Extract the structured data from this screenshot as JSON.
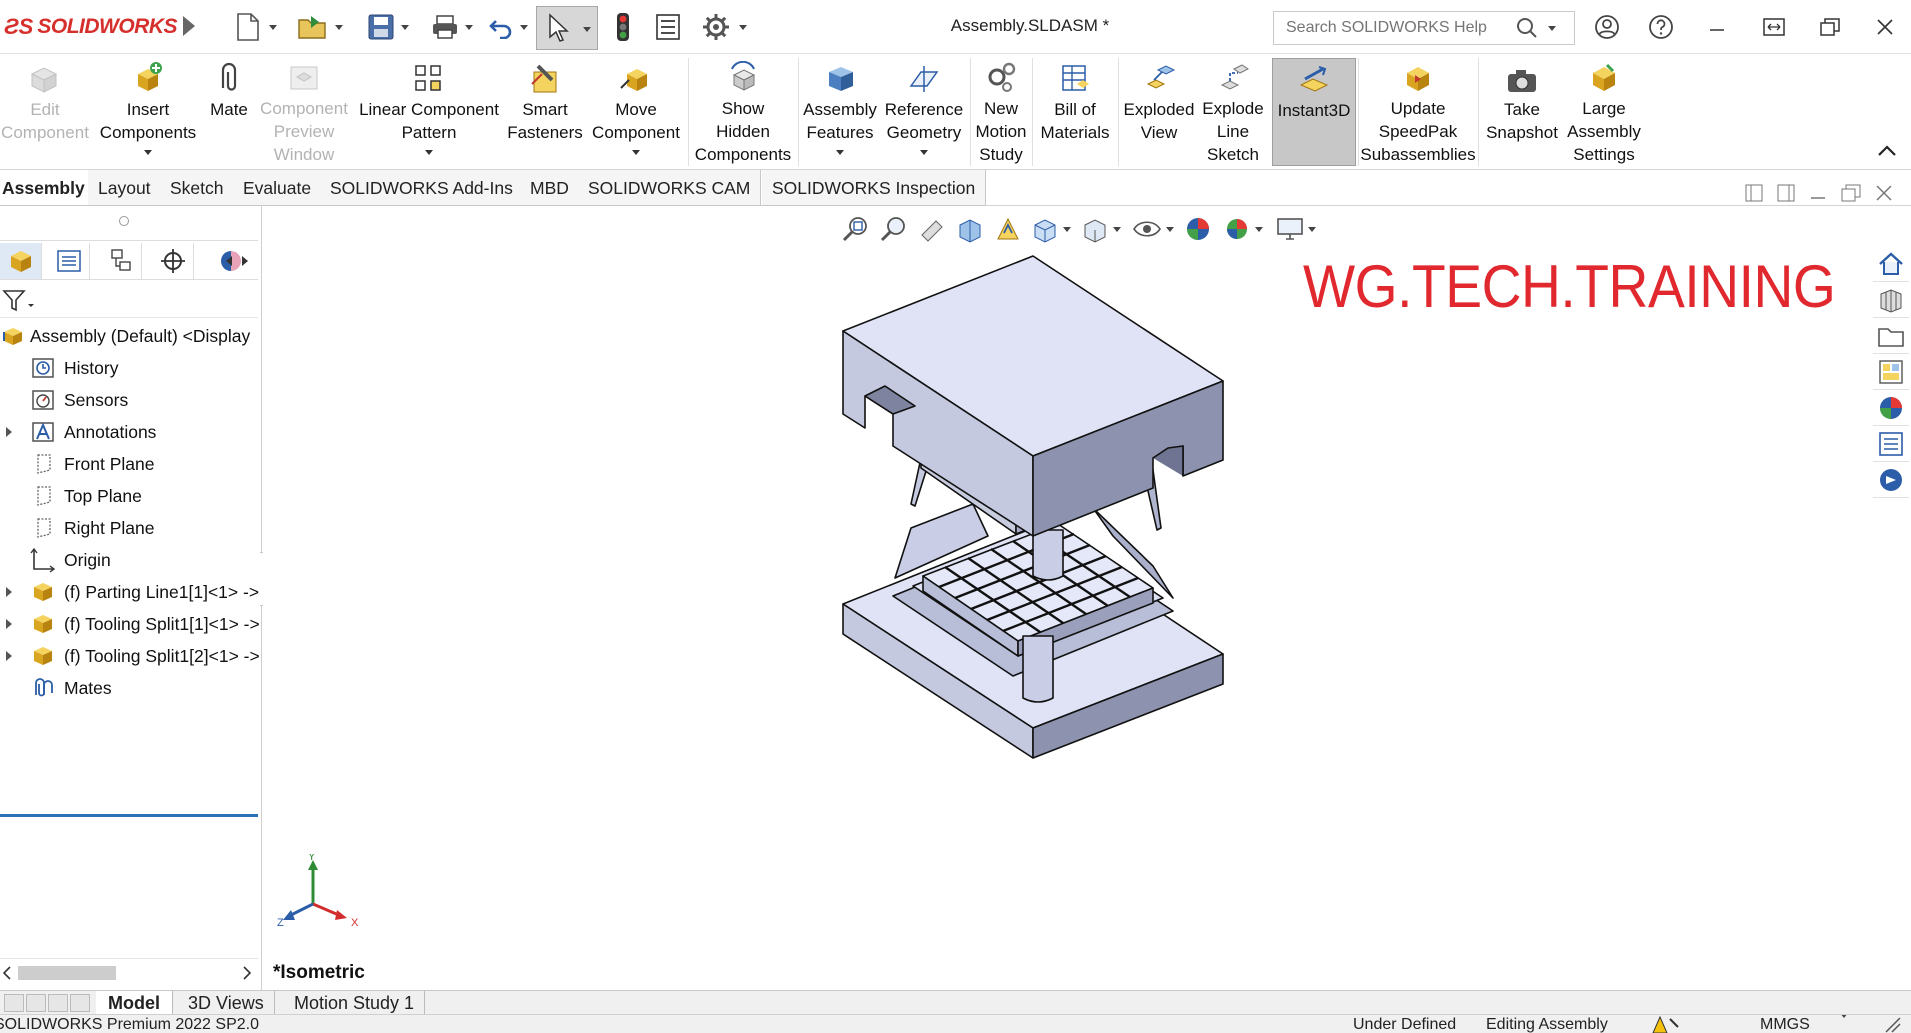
{
  "app": {
    "brand": "SOLIDWORKS",
    "document_title": "Assembly.SLDASM *"
  },
  "search": {
    "placeholder": "Search SOLIDWORKS Help"
  },
  "ribbon": {
    "edit_component": [
      "Edit",
      "Component"
    ],
    "insert_components": [
      "Insert",
      "Components"
    ],
    "mate": [
      "Mate"
    ],
    "component_preview": [
      "Component",
      "Preview",
      "Window"
    ],
    "linear_pattern": [
      "Linear Component",
      "Pattern"
    ],
    "smart_fasteners": [
      "Smart",
      "Fasteners"
    ],
    "move_component": [
      "Move",
      "Component"
    ],
    "show_hidden": [
      "Show",
      "Hidden",
      "Components"
    ],
    "assembly_features": [
      "Assembly",
      "Features"
    ],
    "reference_geometry": [
      "Reference",
      "Geometry"
    ],
    "new_motion_study": [
      "New",
      "Motion",
      "Study"
    ],
    "bill_of_materials": [
      "Bill of",
      "Materials"
    ],
    "exploded_view": [
      "Exploded",
      "View"
    ],
    "explode_line_sketch": [
      "Explode",
      "Line",
      "Sketch"
    ],
    "instant3d": [
      "Instant3D"
    ],
    "update_speedpak": [
      "Update",
      "SpeedPak",
      "Subassemblies"
    ],
    "take_snapshot": [
      "Take",
      "Snapshot"
    ],
    "large_assembly": [
      "Large",
      "Assembly",
      "Settings"
    ]
  },
  "command_tabs": [
    "Assembly",
    "Layout",
    "Sketch",
    "Evaluate",
    "SOLIDWORKS Add-Ins",
    "MBD",
    "SOLIDWORKS CAM",
    "SOLIDWORKS Inspection"
  ],
  "tree": {
    "root": "Assembly (Default) <Display",
    "items": [
      "History",
      "Sensors",
      "Annotations",
      "Front Plane",
      "Top Plane",
      "Right Plane",
      "Origin",
      "(f) Parting Line1[1]<1> ->",
      "(f) Tooling Split1[1]<1> ->",
      "(f) Tooling Split1[2]<1> ->",
      "Mates"
    ]
  },
  "graphics": {
    "watermark": "WG.TECH.TRAINING",
    "view_label": "*Isometric",
    "triad": {
      "x": "X",
      "y": "Y",
      "z": "Z"
    }
  },
  "bottom_tabs": [
    "Model",
    "3D Views",
    "Motion Study 1"
  ],
  "status": {
    "product": "SOLIDWORKS Premium 2022 SP2.0",
    "definition": "Under Defined",
    "mode": "Editing Assembly",
    "units": "MMGS"
  },
  "colors": {
    "brand_red": "#d6302d",
    "watermark_red": "#e0282e",
    "accent_blue": "#2a72b6",
    "model_face": "#d8dcf2"
  }
}
